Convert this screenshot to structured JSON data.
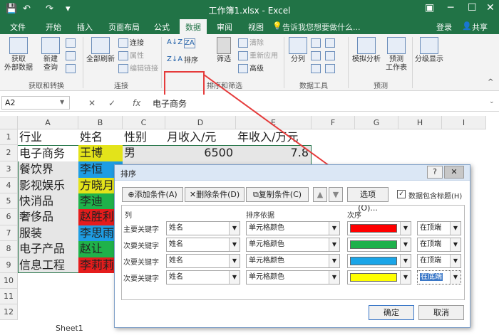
{
  "title": "工作簿1.xlsx - Excel",
  "tabs": [
    "文件",
    "开始",
    "插入",
    "页面布局",
    "公式",
    "数据",
    "审阅",
    "视图"
  ],
  "tell_me": "告诉我您想要做什么...",
  "account": {
    "login": "登录",
    "share": "共享"
  },
  "ribbon": {
    "get_external": "获取\n外部数据",
    "new_query": "新建\n查询",
    "refresh_all": "全部刷新",
    "connections": "连接",
    "properties": "属性",
    "edit_links": "编辑链接",
    "sort": "排序",
    "filter": "筛选",
    "clear": "清除",
    "reapply": "重新应用",
    "advanced": "高级",
    "split": "分列",
    "whatif": "模拟分析",
    "forecast": "预测\n工作表",
    "outline": "分级显示",
    "groups": {
      "get_transform": "获取和转换",
      "connections": "连接",
      "sort_filter": "排序和筛选",
      "data_tools": "数据工具",
      "forecast": "预测"
    }
  },
  "formula_bar": {
    "name_box": "A2",
    "cancel": "✕",
    "enter": "✓",
    "fx": "fx",
    "content": "电子商务"
  },
  "columns": [
    "A",
    "B",
    "C",
    "D",
    "E",
    "F",
    "G",
    "H",
    "I"
  ],
  "rows": [
    "1",
    "2",
    "3",
    "4",
    "5",
    "6",
    "7",
    "8",
    "9",
    "10",
    "11",
    "12"
  ],
  "cells": {
    "headers": [
      "行业",
      "姓名",
      "性别",
      "月收入/元",
      "年收入/万元"
    ],
    "industries": [
      "电子商务",
      "餐饮界",
      "影视娱乐",
      "快消品",
      "奢侈品",
      "服装",
      "电子产品",
      "信息工程"
    ],
    "names": [
      "王博",
      "李恒",
      "方晓月",
      "李迪",
      "赵胜利",
      "李思雨",
      "赵让",
      "李莉莉"
    ],
    "gender_row2": "男",
    "monthly_row2": "6500",
    "yearly_row2": "7.8",
    "name_colors": [
      "#e3e31a",
      "#1e9de3",
      "#e3e31a",
      "#1fb24a",
      "#e51c1c",
      "#1e9de3",
      "#1fb24a",
      "#e51c1c"
    ]
  },
  "sort_dialog": {
    "title": "排序",
    "help": "?",
    "close": "✕",
    "add_level": "添加条件(A)",
    "delete_level": "删除条件(D)",
    "copy_level": "复制条件(C)",
    "options": "选项(O)...",
    "has_headers": "数据包含标题(H)",
    "col_header": "列",
    "sort_on_header": "排序依据",
    "order_header": "次序",
    "levels": [
      {
        "key_label": "主要关键字",
        "column": "姓名",
        "sort_on": "单元格颜色",
        "color": "#ff0000",
        "position": "在顶端"
      },
      {
        "key_label": "次要关键字",
        "column": "姓名",
        "sort_on": "单元格颜色",
        "color": "#1db14b",
        "position": "在顶端"
      },
      {
        "key_label": "次要关键字",
        "column": "姓名",
        "sort_on": "单元格颜色",
        "color": "#1aa5e8",
        "position": "在顶端"
      },
      {
        "key_label": "次要关键字",
        "column": "姓名",
        "sort_on": "单元格颜色",
        "color": "#ffff00",
        "position": "在底端"
      }
    ],
    "ok": "确定",
    "cancel": "取消"
  },
  "sheet_tab": "Sheet1"
}
